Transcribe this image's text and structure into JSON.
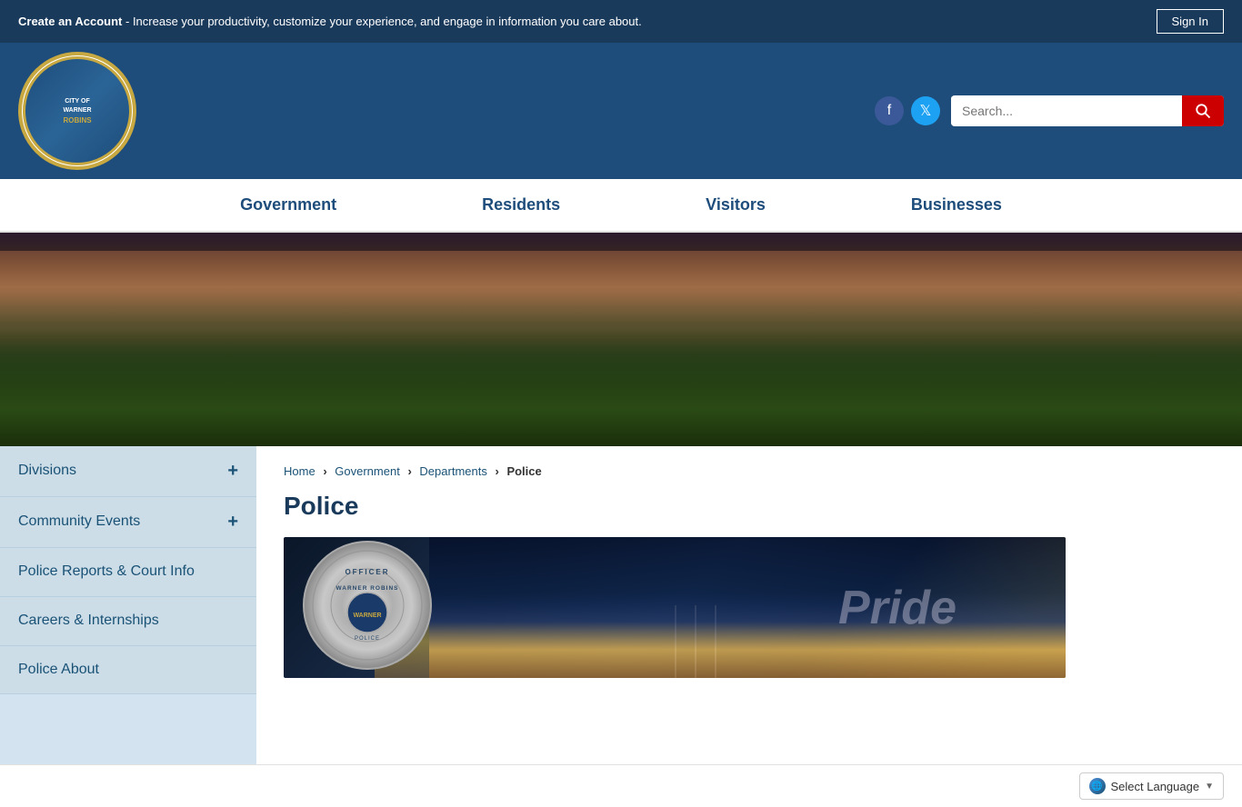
{
  "topbar": {
    "account_text": "Create an Account",
    "account_subtitle": " - Increase your productivity, customize your experience, and engage in information you care about.",
    "signin_label": "Sign In"
  },
  "header": {
    "logo": {
      "line1": "CITY OF",
      "line2": "WARNER",
      "line3": "ROBINS"
    },
    "search_placeholder": "Search..."
  },
  "nav": {
    "items": [
      {
        "label": "Government",
        "id": "government"
      },
      {
        "label": "Residents",
        "id": "residents"
      },
      {
        "label": "Visitors",
        "id": "visitors"
      },
      {
        "label": "Businesses",
        "id": "businesses"
      }
    ]
  },
  "breadcrumb": {
    "home": "Home",
    "government": "Government",
    "departments": "Departments",
    "current": "Police"
  },
  "page": {
    "title": "Police"
  },
  "sidebar": {
    "items": [
      {
        "label": "Divisions",
        "has_plus": true,
        "id": "divisions"
      },
      {
        "label": "Community Events",
        "has_plus": true,
        "id": "community-events"
      },
      {
        "label": "Police Reports & Court Info",
        "has_plus": false,
        "id": "police-reports"
      },
      {
        "label": "Careers & Internships",
        "has_plus": false,
        "id": "careers"
      },
      {
        "label": "Police About",
        "has_plus": false,
        "id": "police-about"
      }
    ]
  },
  "police_image": {
    "badge_line1": "OFFICER",
    "badge_line2": "WARNER ROBINS",
    "badge_line3": "WARNER",
    "pride_text": "Pride"
  },
  "language": {
    "label": "Select Language"
  },
  "social": {
    "facebook_title": "Facebook",
    "twitter_title": "Twitter"
  }
}
